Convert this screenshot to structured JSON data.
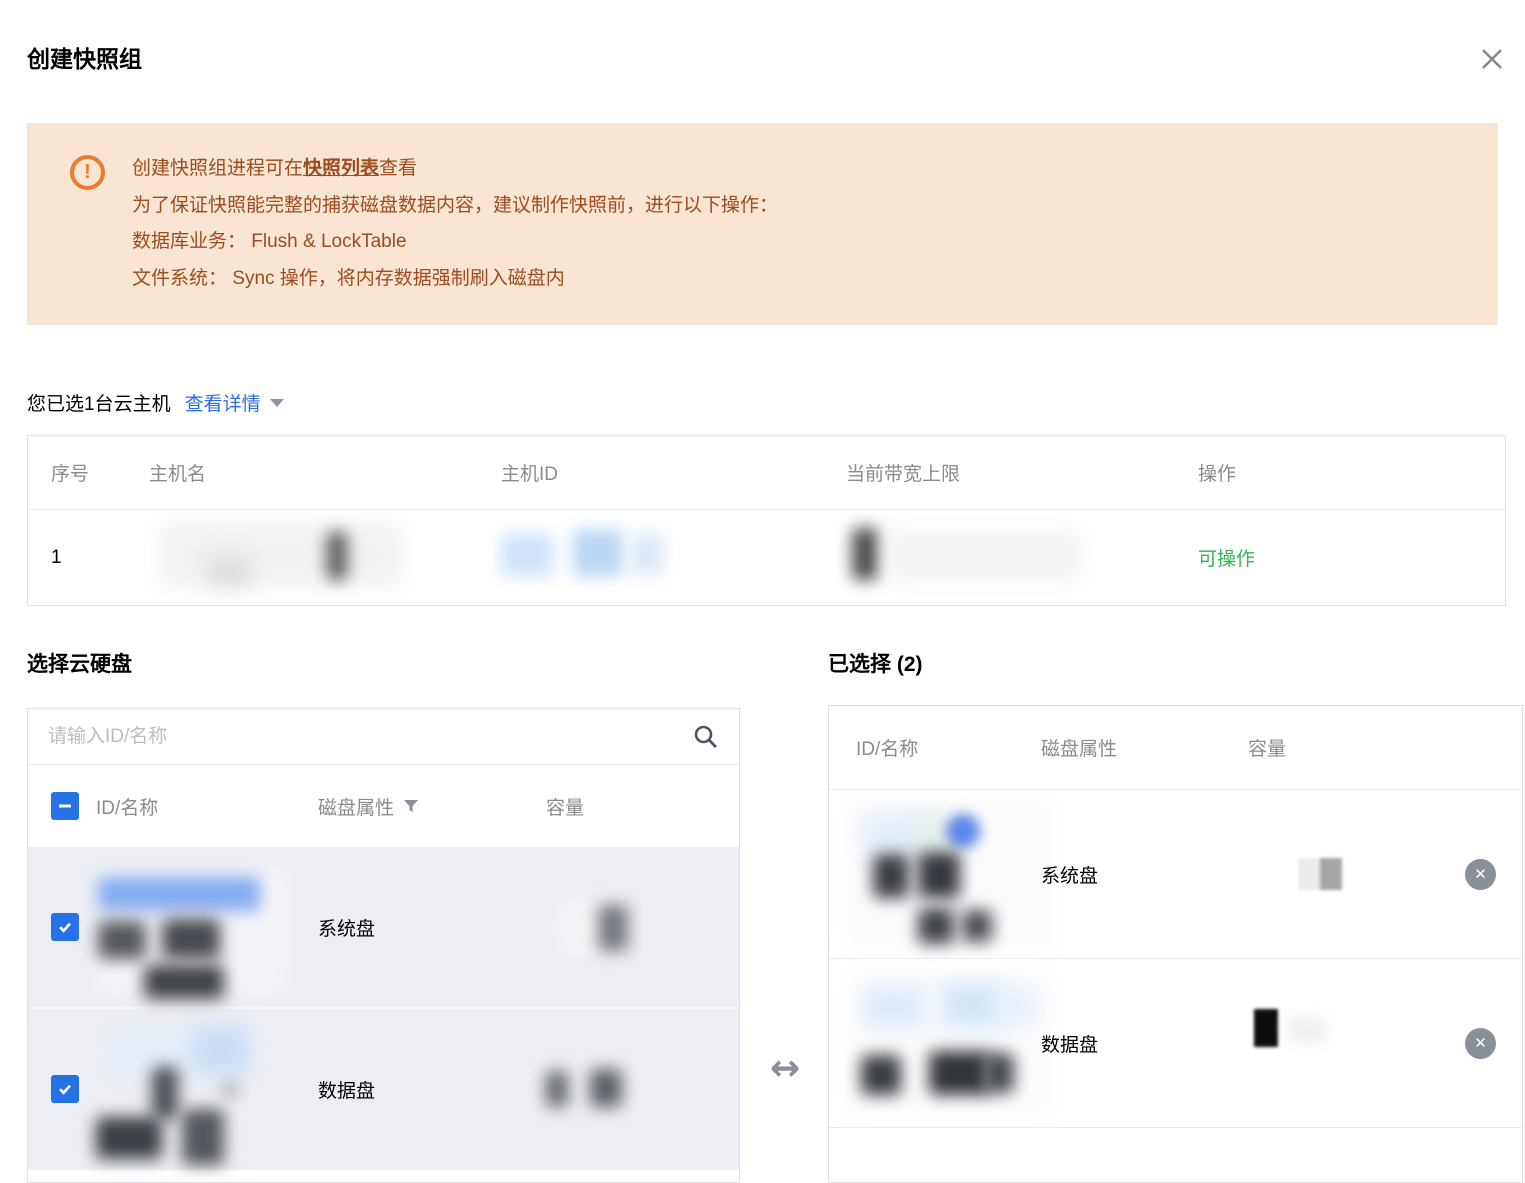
{
  "icons": {
    "warning": "!",
    "remove": "✕",
    "transfer_arrow": "↔"
  },
  "dialog": {
    "title": "创建快照组"
  },
  "banner": {
    "line1_prefix": "创建快照组进程可在",
    "line1_link": "快照列表",
    "line1_suffix": "查看",
    "line2": "为了保证快照能完整的捕获磁盘数据内容，建议制作快照前，进行以下操作：",
    "line3": "数据库业务： Flush & LockTable",
    "line4": "文件系统： Sync 操作，将内存数据强制刷入磁盘内"
  },
  "selection": {
    "summary": "您已选1台云主机",
    "detail_link": "查看详情"
  },
  "host_table": {
    "headers": [
      "序号",
      "主机名",
      "主机ID",
      "当前带宽上限",
      "操作"
    ],
    "row": {
      "index": "1",
      "action": "可操作"
    }
  },
  "disk_picker": {
    "left_title": "选择云硬盘",
    "right_title": "已选择 (2)",
    "search_placeholder": "请输入ID/名称",
    "columns": [
      "ID/名称",
      "磁盘属性",
      "容量"
    ],
    "left_rows": [
      {
        "disk_type": "系统盘",
        "checked": true
      },
      {
        "disk_type": "数据盘",
        "checked": true
      }
    ],
    "right_rows": [
      {
        "disk_type": "系统盘"
      },
      {
        "disk_type": "数据盘"
      }
    ]
  },
  "colors": {
    "accent_blue": "#2670e8",
    "warning_orange": "#ed7b2f",
    "banner_bg": "#f9e5d2",
    "banner_text": "#9d4c20",
    "status_green": "#33b354"
  }
}
